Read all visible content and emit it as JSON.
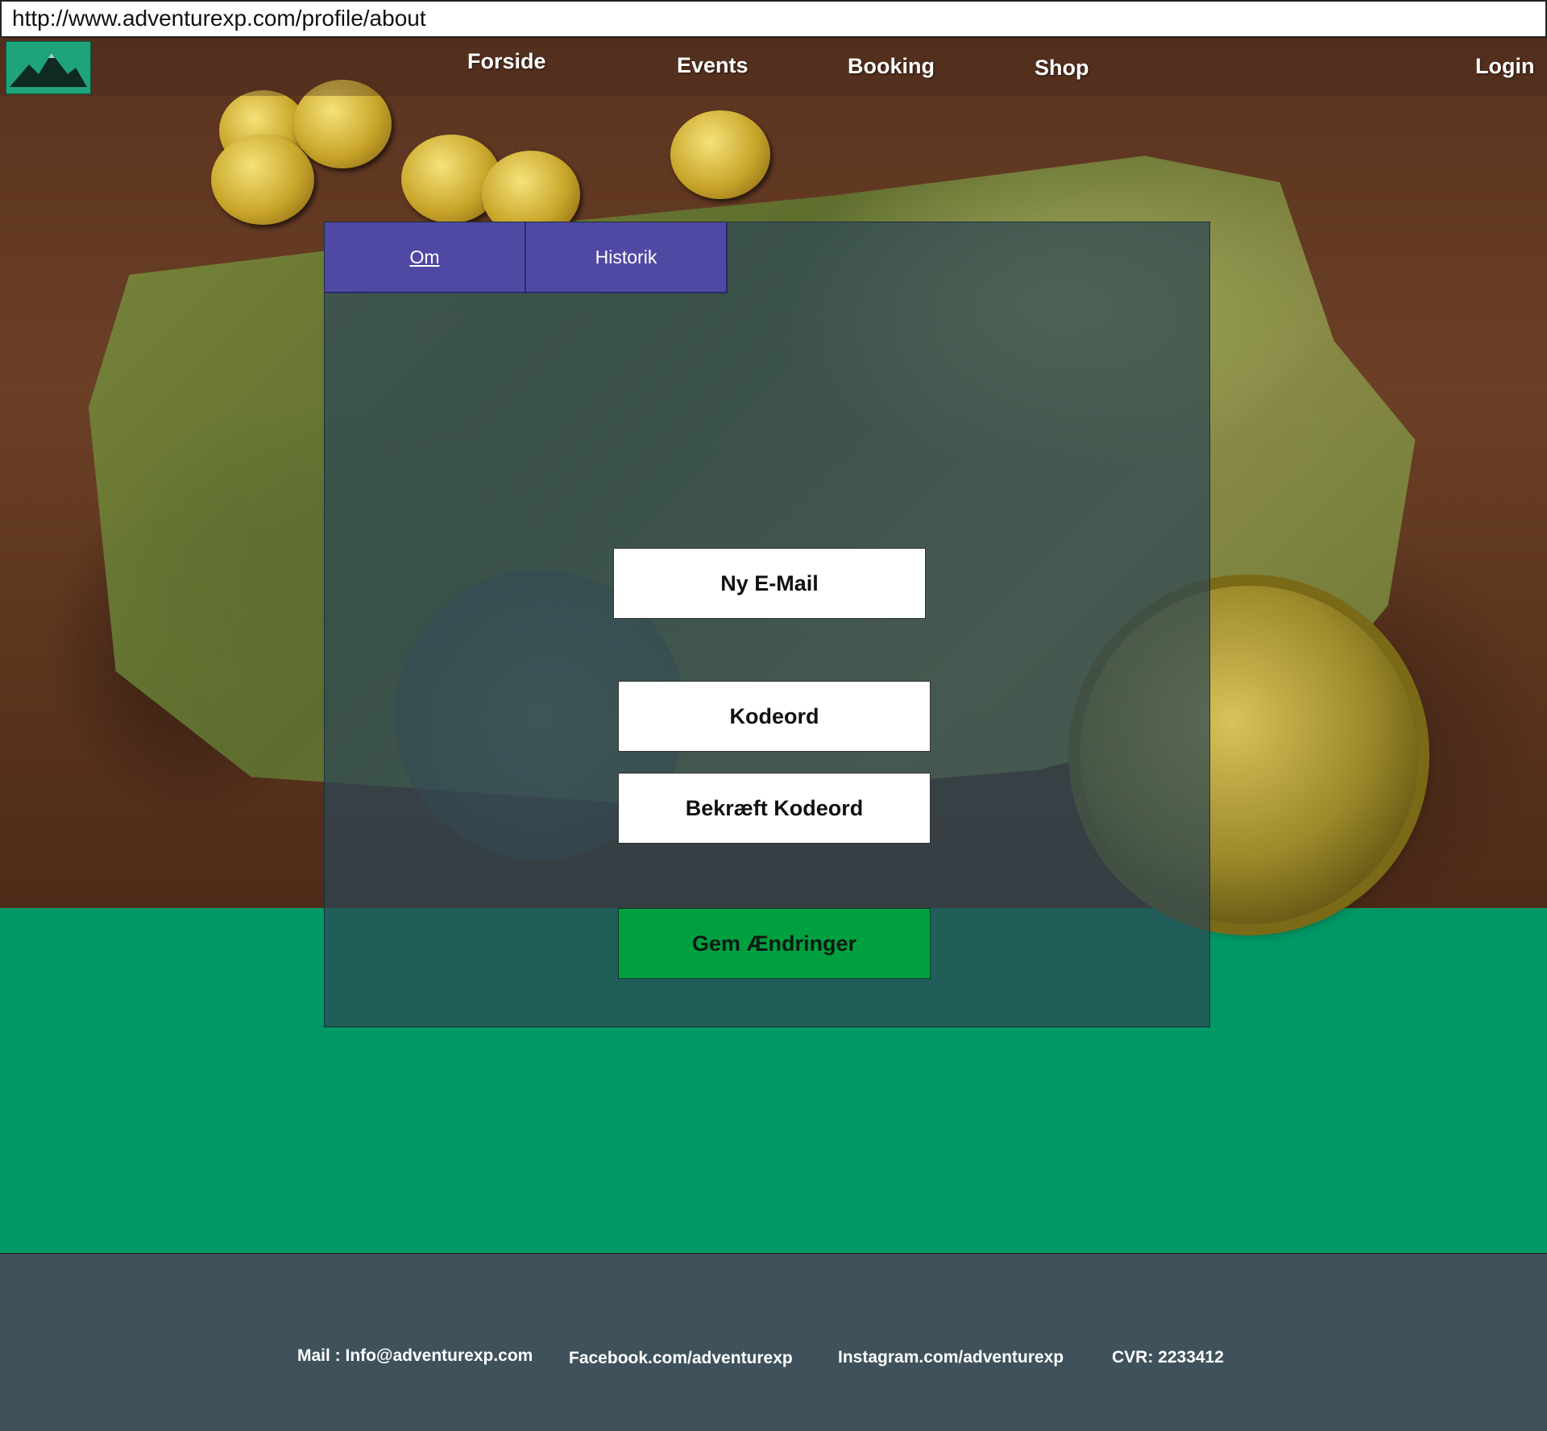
{
  "browser": {
    "url": "http://www.adventurexp.com/profile/about"
  },
  "nav": {
    "logo_icon": "mountain-icon",
    "links": [
      "Forside",
      "Events",
      "Booking",
      "Shop"
    ],
    "login": "Login"
  },
  "tabs": [
    {
      "label": "Om",
      "active": true
    },
    {
      "label": "Historik",
      "active": false
    }
  ],
  "form": {
    "email_placeholder": "Ny E-Mail",
    "password_placeholder": "Kodeord",
    "confirm_placeholder": "Bekræft Kodeord",
    "save_label": "Gem Ændringer"
  },
  "footer": {
    "mail": "Mail : Info@adventurexp.com",
    "facebook": "Facebook.com/adventurexp",
    "instagram": "Instagram.com/adventurexp",
    "cvr": "CVR: 2233412"
  },
  "colors": {
    "tab": "#5049a3",
    "save_button": "#00a040",
    "page_green": "#009966",
    "footer": "#3f525c",
    "logo": "#1fa37a"
  }
}
